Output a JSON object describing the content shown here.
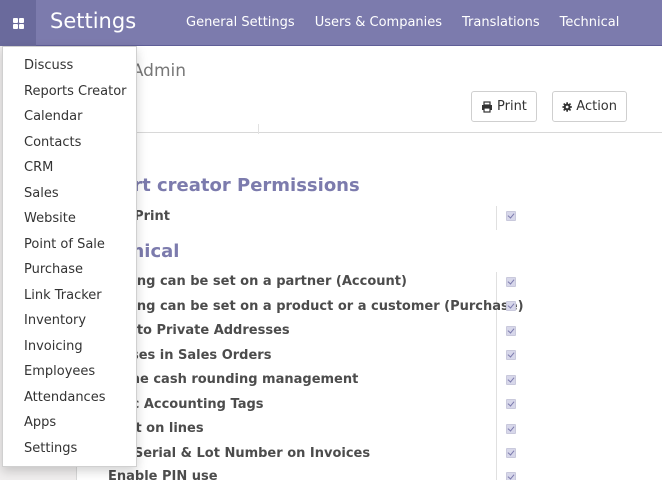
{
  "navbar": {
    "brand": "Settings",
    "menu": [
      {
        "label": "General Settings"
      },
      {
        "label": "Users & Companies"
      },
      {
        "label": "Translations"
      },
      {
        "label": "Technical"
      }
    ],
    "apps_icon": "apps-grid-icon"
  },
  "apps_dropdown": {
    "items": [
      {
        "label": "Discuss"
      },
      {
        "label": "Reports Creator"
      },
      {
        "label": "Calendar"
      },
      {
        "label": "Contacts"
      },
      {
        "label": "CRM"
      },
      {
        "label": "Sales"
      },
      {
        "label": "Website"
      },
      {
        "label": "Point of Sale"
      },
      {
        "label": "Purchase"
      },
      {
        "label": "Link Tracker"
      },
      {
        "label": "Inventory"
      },
      {
        "label": "Invoicing"
      },
      {
        "label": "Employees"
      },
      {
        "label": "Attendances"
      },
      {
        "label": "Apps"
      },
      {
        "label": "Settings"
      }
    ]
  },
  "control_panel": {
    "breadcrumb": "ll Admin",
    "print_label": "Print",
    "print_icon": "print-icon",
    "action_label": "Action",
    "action_icon": "gear-icon"
  },
  "sheet": {
    "groups": [
      {
        "title": "port creator Permissions",
        "rows": [
          {
            "label": "ort Print",
            "checked": true
          }
        ]
      },
      {
        "title": "chnical",
        "rows": [
          {
            "label": "arning can be set on a partner (Account)",
            "checked": true
          },
          {
            "label": "arning can be set on a product or a customer (Purchase)",
            "checked": true
          },
          {
            "label": "ess to Private Addresses",
            "checked": true
          },
          {
            "label": "resses in Sales Orders",
            "checked": true
          },
          {
            "label": "w the cash rounding management",
            "checked": true
          },
          {
            "label": "lytic Accounting Tags",
            "checked": true
          },
          {
            "label": "ount on lines",
            "checked": true
          },
          {
            "label": "lay Serial & Lot Number on Invoices",
            "checked": true
          },
          {
            "label": "Enable PIN use",
            "checked": true
          }
        ]
      }
    ]
  },
  "colors": {
    "navbar": "#7c7bad",
    "accent": "#7c7bad",
    "text": "#4c4c4c"
  }
}
